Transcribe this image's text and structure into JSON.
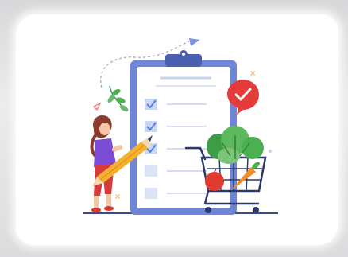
{
  "image": {
    "subject": "checklist-shopping-illustration",
    "colors": {
      "clipboard_frame": "#6f86d8",
      "paper": "#ffffff",
      "check_box": "#c9d8f5",
      "check_mark": "#5b7ee0",
      "badge": "#e63b3b",
      "shirt": "#7b4bd6",
      "pants": "#d63a3a",
      "pencil": "#f5b02e",
      "cart": "#2e3a6e",
      "greens": "#4caf50",
      "carrot": "#f28c28",
      "apple": "#e03c31"
    }
  }
}
